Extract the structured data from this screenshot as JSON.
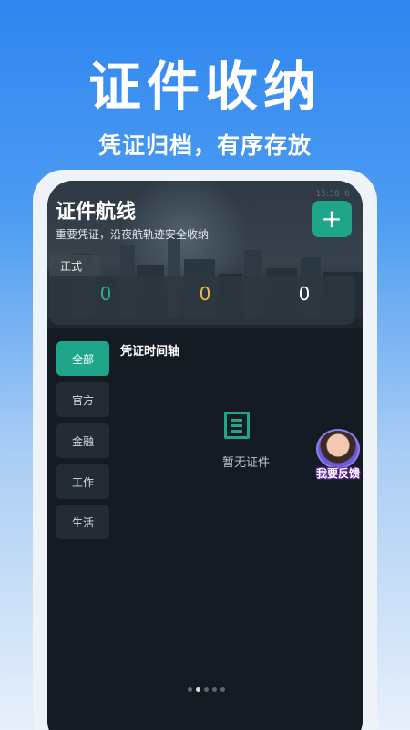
{
  "promo": {
    "title": "证件收纳",
    "subtitle": "凭证归档，有序存放"
  },
  "status_bar": {
    "text": "15:38 ·8"
  },
  "header": {
    "title": "证件航线",
    "subtitle": "重要凭证，沿夜航轨迹安全收纳",
    "add_icon": "plus-icon",
    "add_label": "+"
  },
  "env_tag": "正式",
  "stats": [
    "0",
    "0",
    "0"
  ],
  "stat_colors": [
    "#27b08f",
    "#e9b955",
    "#ffffff"
  ],
  "categories": [
    {
      "label": "全部",
      "active": true
    },
    {
      "label": "官方",
      "active": false
    },
    {
      "label": "金融",
      "active": false
    },
    {
      "label": "工作",
      "active": false
    },
    {
      "label": "生活",
      "active": false
    }
  ],
  "timeline": {
    "title": "凭证时间轴",
    "empty_icon": "document-icon",
    "empty_text": "暂无证件"
  },
  "pager": {
    "count": 5,
    "active_index": 1
  },
  "feedback": {
    "label": "我要反馈",
    "icon": "customer-service-avatar-icon"
  },
  "colors": {
    "accent": "#1fa68a",
    "screen_bg": "#151b23",
    "brand_blue": "#2f86f0"
  }
}
